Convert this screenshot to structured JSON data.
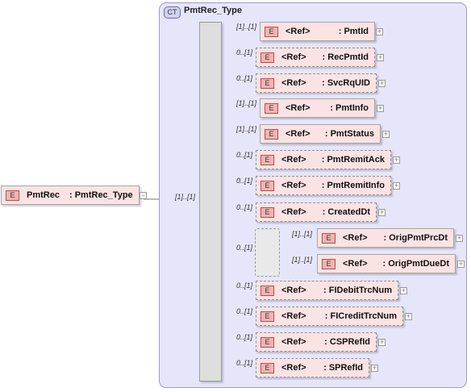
{
  "complex_type": {
    "badge": "CT",
    "name": "PmtRec_Type"
  },
  "root": {
    "badge": "E",
    "name": "PmtRec",
    "type": ": PmtRec_Type",
    "cardinality": "[1]..[1]"
  },
  "sequence": [
    {
      "ref": "<Ref>",
      "name": ": PmtId",
      "cardinality": "[1]..[1]",
      "optional": false
    },
    {
      "ref": "<Ref>",
      "name": ": RecPmtId",
      "cardinality": "0..[1]",
      "optional": true
    },
    {
      "ref": "<Ref>",
      "name": ": SvcRqUID",
      "cardinality": "0..[1]",
      "optional": true
    },
    {
      "ref": "<Ref>",
      "name": ": PmtInfo",
      "cardinality": "[1]..[1]",
      "optional": false
    },
    {
      "ref": "<Ref>",
      "name": ": PmtStatus",
      "cardinality": "[1]..[1]",
      "optional": false
    },
    {
      "ref": "<Ref>",
      "name": ": PmtRemitAck",
      "cardinality": "0..[1]",
      "optional": true
    },
    {
      "ref": "<Ref>",
      "name": ": PmtRemitInfo",
      "cardinality": "0..[1]",
      "optional": true
    },
    {
      "ref": "<Ref>",
      "name": ": CreatedDt",
      "cardinality": "0..[1]",
      "optional": true
    }
  ],
  "choice": {
    "cardinality": "0..[1]",
    "items": [
      {
        "ref": "<Ref>",
        "name": ": OrigPmtPrcDt",
        "cardinality": "[1]..[1]"
      },
      {
        "ref": "<Ref>",
        "name": ": OrigPmtDueDt",
        "cardinality": "[1]..[1]"
      }
    ]
  },
  "sequence_after": [
    {
      "ref": "<Ref>",
      "name": ": FIDebitTrcNum",
      "cardinality": "0..[1]",
      "optional": true
    },
    {
      "ref": "<Ref>",
      "name": ": FICreditTrcNum",
      "cardinality": "0..[1]",
      "optional": true
    },
    {
      "ref": "<Ref>",
      "name": ": CSPRefId",
      "cardinality": "0..[1]",
      "optional": true
    },
    {
      "ref": "<Ref>",
      "name": ": SPRefId",
      "cardinality": "0..[1]",
      "optional": true
    }
  ],
  "element_badge": "E",
  "expand_glyph": "+",
  "collapse_glyph": "−",
  "colors": {
    "element_fill": "#fce3e3",
    "complex_type_fill": "#e6e6fb"
  }
}
